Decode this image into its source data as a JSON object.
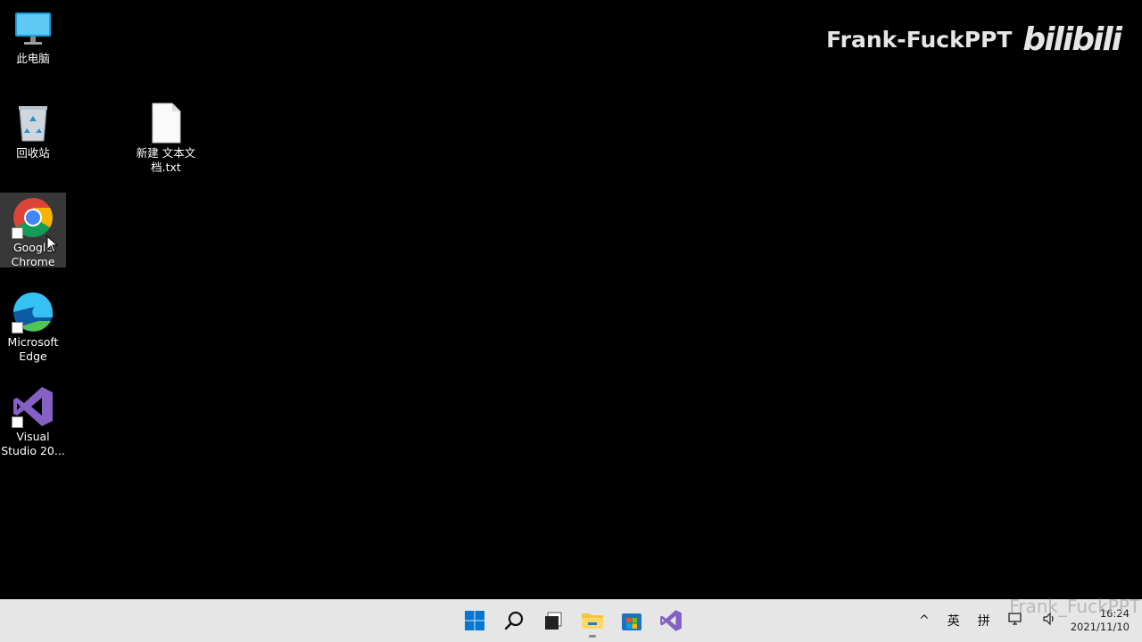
{
  "desktop": {
    "icons": [
      {
        "label": "此电脑"
      },
      {
        "label": "回收站"
      },
      {
        "label": "新建 文本文档.txt"
      },
      {
        "label": "Google Chrome"
      },
      {
        "label": "Microsoft Edge"
      },
      {
        "label": "Visual Studio 20..."
      }
    ]
  },
  "watermark": {
    "text": "Frank-FuckPPT",
    "logo": "bilibili"
  },
  "watermark2": {
    "text": "Frank_FuckPPT"
  },
  "taskbar": {
    "apps": [
      "start-icon",
      "search-icon",
      "task-view-icon",
      "file-explorer-icon",
      "microsoft-store-icon",
      "visual-studio-icon"
    ],
    "tray": {
      "chevron": "^",
      "lang": "英",
      "ime": "拼"
    },
    "clock": {
      "time": "16:24",
      "date": "2021/11/10"
    }
  },
  "colors": {
    "accent": "#0078d4",
    "taskbar": "#e6e6e6",
    "desktop": "#000000"
  }
}
